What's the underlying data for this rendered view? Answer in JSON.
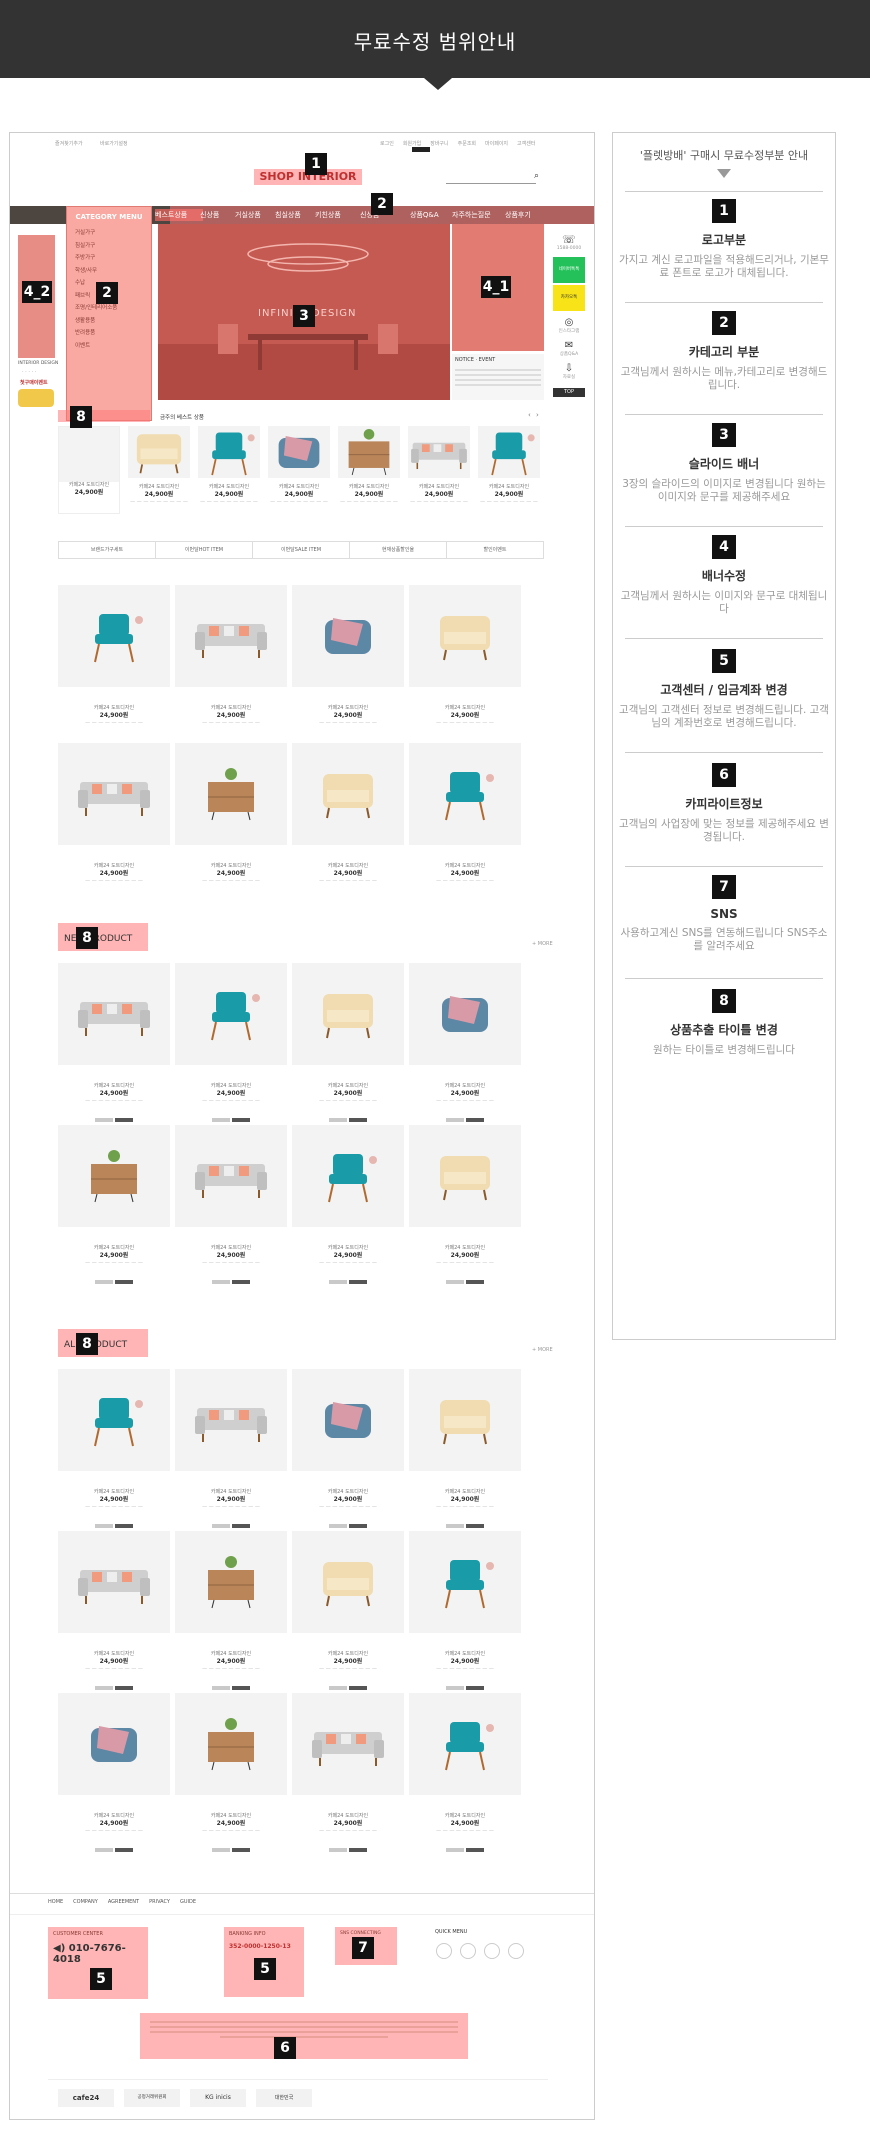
{
  "header": {
    "title": "무료수정 범위안내"
  },
  "preview": {
    "topbar_left": [
      "즐겨찾기추가",
      "바로가기설정"
    ],
    "topbar_right": [
      "로그인",
      "회원가입",
      "장바구니",
      "주문조회",
      "마이페이지",
      "고객센터"
    ],
    "logo": "SHOP INTERIOR",
    "nav_items": [
      "베스트상품",
      "신상품",
      "거실상품",
      "침실상품",
      "키친상품",
      "신상품",
      "상품Q&A",
      "자주하는질문",
      "상품후기"
    ],
    "category_title": "CATEGORY MENU",
    "category_items": [
      "거실가구",
      "침실가구",
      "주방가구",
      "학생/사무",
      "수납",
      "패브릭",
      "조명/인테리어소품",
      "생활용품",
      "반려용품",
      "이벤트"
    ],
    "slider_text": "INFINITY DESIGN",
    "left_banner_label": "INTERIOR DESIGN",
    "left_banner_event": "첫구매이벤트",
    "right_banner_title": "NOTICE · EVENT",
    "side_cs": "1588-0000",
    "side_labels": [
      "네이버톡톡",
      "카카오톡",
      "인스타그램",
      "상품Q&A",
      "자료실"
    ],
    "top_btn": "TOP",
    "best_label": "금주의 베스트 상품",
    "cat_tabs": [
      "브랜드가구세트",
      "이번달HOT ITEM",
      "이번달SALE ITEM",
      "현재상품할인율",
      "할인이벤트"
    ],
    "product_name": "카페24 도트디자인",
    "product_price": "24,900원",
    "new_title": "NEW PRODUCT",
    "all_title": "ALL PRODUCT",
    "footer_links": [
      "HOME",
      "COMPANY",
      "AGREEMENT",
      "PRIVACY",
      "GUIDE"
    ],
    "cs_title": "CUSTOMER CENTER",
    "cs_phone": "010-7676-4018",
    "bank_title": "BANKING INFO",
    "bank_account": "352-0000-1250-13",
    "sns_title": "SNS CONNECTING",
    "quick_title": "QUICK MENU",
    "partners": [
      "cafe24",
      "공정거래위원회",
      "KG inicis",
      "대한민국"
    ]
  },
  "panel": {
    "heading": "'플렛방배' 구매시 무료수정부분 안내",
    "sections": [
      {
        "num": "1",
        "title": "로고부분",
        "desc": "가지고 계신 로고파일을 적용해드리거나, 기본무료 폰트로 로고가 대체됩니다."
      },
      {
        "num": "2",
        "title": "카테고리 부분",
        "desc": "고객님께서 원하시는 메뉴,카테고리로 변경해드립니다."
      },
      {
        "num": "3",
        "title": "슬라이드 배너",
        "desc": "3장의 슬라이드의 이미지로 변경됩니다 원하는 이미지와 문구를 제공해주세요"
      },
      {
        "num": "4",
        "title": "배너수정",
        "desc": "고객님께서 원하시는 이미지와 문구로 대체됩니다"
      },
      {
        "num": "5",
        "title": "고객센터 / 입금계좌 변경",
        "desc": "고객님의 고객센터 정보로 변경해드립니다. 고객님의 계좌번호로 변경해드립니다."
      },
      {
        "num": "6",
        "title": "카피라이트정보",
        "desc": "고객님의 사업장에 맞는 정보를 제공해주세요 변경됩니다."
      },
      {
        "num": "7",
        "title": "SNS",
        "desc": "사용하고계신 SNS를 연동해드립니다 SNS주소를 알려주세요"
      },
      {
        "num": "8",
        "title": "상품추출 타이틀 변경",
        "desc": "원하는 타이틀로 변경해드립니다"
      }
    ]
  },
  "colors": {
    "highlight": "#ff7878",
    "dark": "#333333",
    "nav": "#4d4540",
    "teal": "#1a9ca8",
    "cream": "#f0dcb0"
  }
}
